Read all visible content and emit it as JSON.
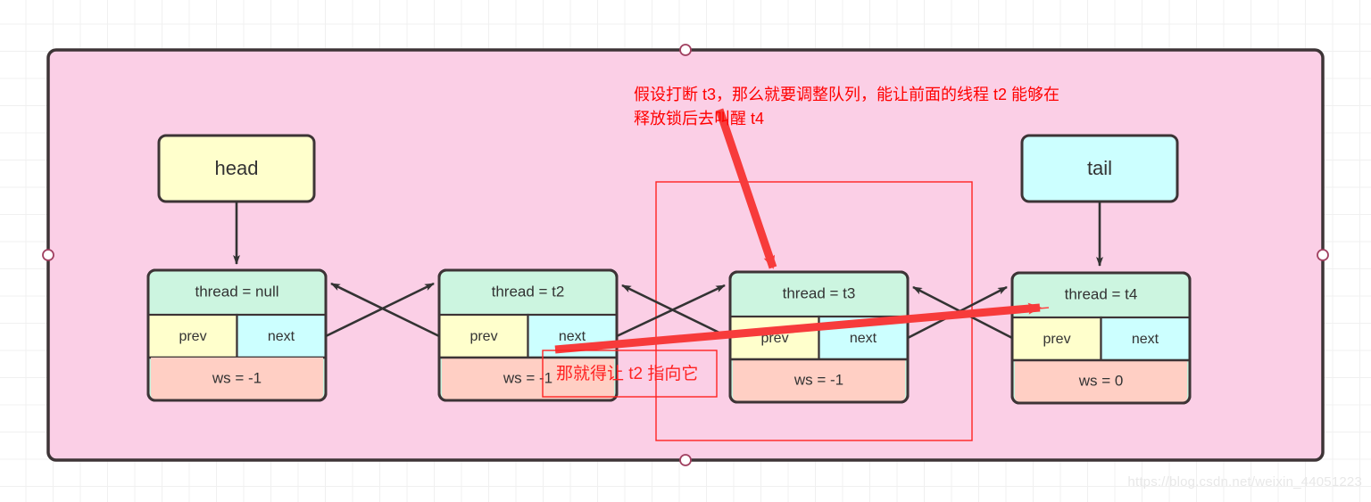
{
  "canvas": {
    "background_color": "#ffffff",
    "grid_color": "#f0f0f0",
    "container_fill": "#fbcfe6",
    "container_stroke": "#3d3436"
  },
  "colors": {
    "thread_row": "#ccf5e0",
    "prev_cell": "#ffffcc",
    "next_cell": "#ccffff",
    "ws_row": "#ffcfc4",
    "head_box": "#ffffcc",
    "tail_box": "#ccffff",
    "node_stroke": "#3d3436",
    "arrow": "#333333",
    "annotation_red": "#ff0000",
    "thick_arrow_red": "#f73b3b",
    "thin_red_line": "#ff4444",
    "red_rect": "#ff2222"
  },
  "endpoints": [
    {
      "name": "head",
      "label": "head",
      "fill": "#ffffcc"
    },
    {
      "name": "tail",
      "label": "tail",
      "fill": "#ccffff"
    }
  ],
  "nodes": [
    {
      "id": "node-head",
      "thread": "thread = null",
      "prev": "prev",
      "next": "next",
      "ws": "ws = -1"
    },
    {
      "id": "node-t2",
      "thread": "thread = t2",
      "prev": "prev",
      "next": "next",
      "ws": "ws = -1"
    },
    {
      "id": "node-t3",
      "thread": "thread = t3",
      "prev": "prev",
      "next": "next",
      "ws": "ws = -1"
    },
    {
      "id": "node-t4",
      "thread": "thread = t4",
      "prev": "prev",
      "next": "next",
      "ws": "ws = 0"
    }
  ],
  "annotations": {
    "main_note_line1": "假设打断 t3，那么就要调整队列，能让前面的线程 t2 能够在",
    "main_note_line2": "释放锁后去叫醒 t4",
    "boxed_note": "那就得让 t2 指向它"
  },
  "watermark": {
    "text": "https://blog.csdn.net/weixin_44051223"
  }
}
